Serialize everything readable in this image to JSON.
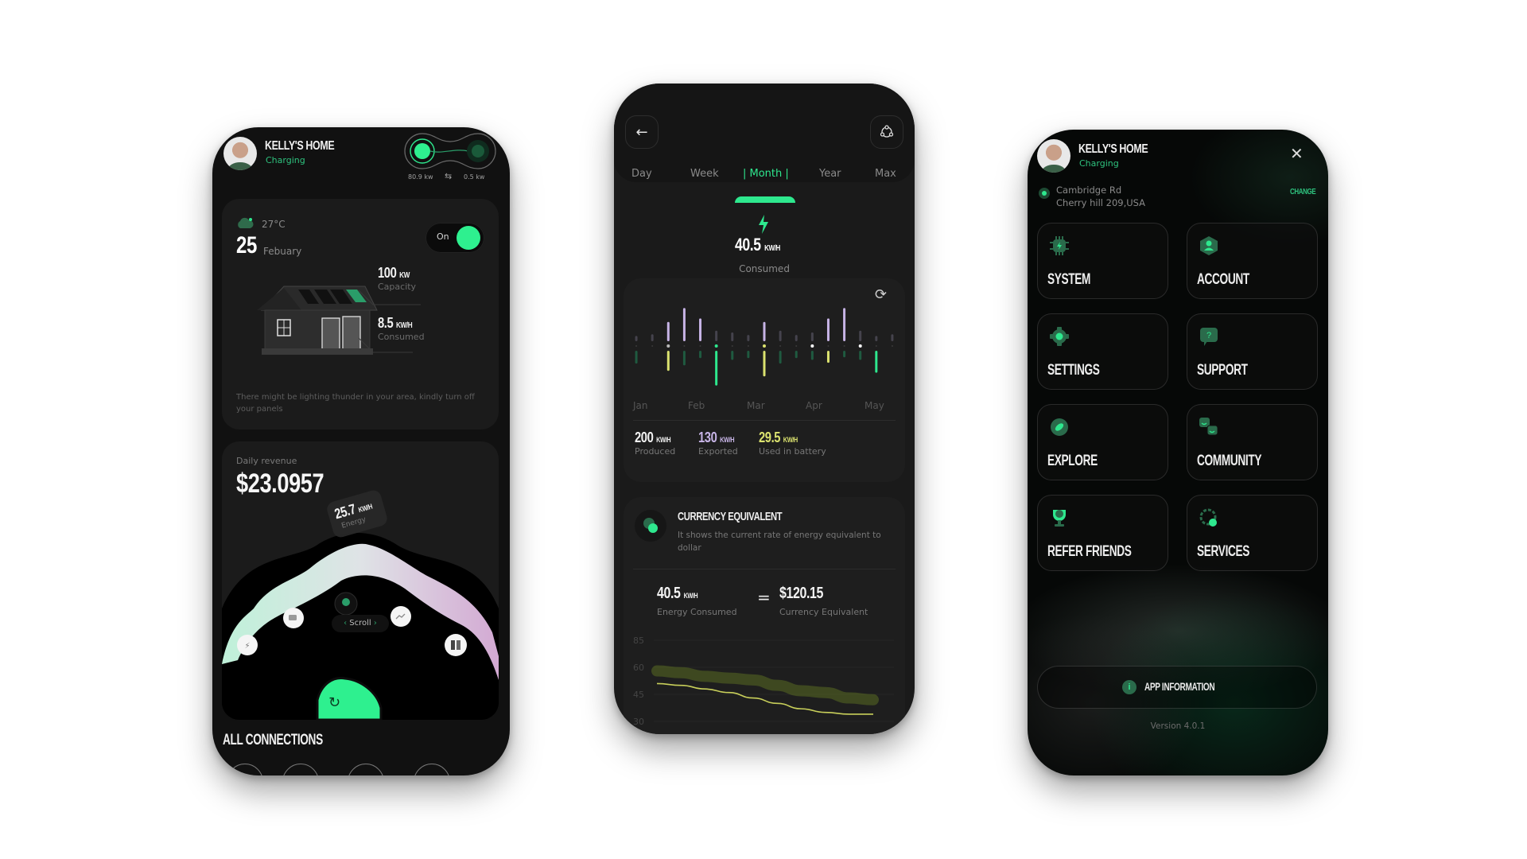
{
  "colors": {
    "accent_green": "#2ee88e",
    "exported_purple": "#c7b4e6",
    "battery_yellow": "#dbe26f",
    "background": "#ffffff"
  },
  "home_screen": {
    "header": {
      "title": "KELLY'S HOME",
      "status": "Charging"
    },
    "energy_flow": {
      "left_value": "80.9 kw",
      "right_value": "0.5 kw",
      "swap_icon": "swap-arrows-icon"
    },
    "weather_card": {
      "weather_icon": "cloud-icon",
      "temperature": "27°C",
      "day": "25",
      "month": "Febuary",
      "toggle_label": "On",
      "toggle_on": true,
      "capacity": {
        "value": "100",
        "unit": "KW",
        "label": "Capacity"
      },
      "consumed": {
        "value": "8.5",
        "unit": "KW/H",
        "label": "Consumed"
      },
      "alert": "There might be lighting thunder in your area, kindly turn off your panels"
    },
    "revenue_card": {
      "label": "Daily revenue",
      "amount": "$23.0957",
      "energy_badge": {
        "value": "25.7",
        "unit": "KW/H",
        "label": "Energy"
      },
      "dial_icons": [
        "lightning-icon",
        "battery-icon",
        "lightbulb-icon",
        "chart-cloud-icon",
        "panel-icon"
      ],
      "scroll_label": "Scroll",
      "refresh_icon": "refresh-icon"
    },
    "connections": {
      "title": "ALL CONNECTIONS"
    }
  },
  "stats_screen": {
    "back_icon": "arrow-left-icon",
    "share_icon": "share-nodes-icon",
    "period_tabs": [
      {
        "label": "Day",
        "active": false
      },
      {
        "label": "Week",
        "active": false
      },
      {
        "label": "| Month |",
        "active": true
      },
      {
        "label": "Year",
        "active": false
      },
      {
        "label": "Max",
        "active": false
      }
    ],
    "consumed": {
      "value": "40.5",
      "unit": "KW/H",
      "label": "Consumed"
    },
    "sync_icon": "sync-icon",
    "month_labels": [
      "Jan",
      "Feb",
      "Mar",
      "Apr",
      "May"
    ],
    "bars": [
      {
        "up": 0.15,
        "down": 0.35,
        "up_color": "dim",
        "down_color": "teal",
        "dot": "none"
      },
      {
        "up": 0.2,
        "down": 0.0,
        "up_color": "dim",
        "down_color": "teal",
        "dot": "none"
      },
      {
        "up": 0.55,
        "down": 0.55,
        "up_color": "purple",
        "down_color": "yellow",
        "dot": "gray"
      },
      {
        "up": 0.95,
        "down": 0.4,
        "up_color": "purple",
        "down_color": "teal",
        "dot": "none"
      },
      {
        "up": 0.65,
        "down": 0.2,
        "up_color": "purple",
        "down_color": "teal",
        "dot": "none"
      },
      {
        "up": 0.3,
        "down": 0.95,
        "up_color": "dim",
        "down_color": "green",
        "dot": "green"
      },
      {
        "up": 0.25,
        "down": 0.25,
        "up_color": "dim",
        "down_color": "teal",
        "dot": "none"
      },
      {
        "up": 0.18,
        "down": 0.2,
        "up_color": "dim",
        "down_color": "teal",
        "dot": "none"
      },
      {
        "up": 0.55,
        "down": 0.7,
        "up_color": "purple",
        "down_color": "yellow",
        "dot": "yellow"
      },
      {
        "up": 0.3,
        "down": 0.35,
        "up_color": "dim",
        "down_color": "teal",
        "dot": "none"
      },
      {
        "up": 0.18,
        "down": 0.2,
        "up_color": "dim",
        "down_color": "teal",
        "dot": "none"
      },
      {
        "up": 0.25,
        "down": 0.25,
        "up_color": "dim",
        "down_color": "teal",
        "dot": "white"
      },
      {
        "up": 0.65,
        "down": 0.33,
        "up_color": "purple",
        "down_color": "yellow",
        "dot": "none"
      },
      {
        "up": 0.95,
        "down": 0.18,
        "up_color": "purple",
        "down_color": "teal",
        "dot": "none"
      },
      {
        "up": 0.3,
        "down": 0.25,
        "up_color": "dim",
        "down_color": "teal",
        "dot": "white"
      },
      {
        "up": 0.15,
        "down": 0.6,
        "up_color": "dim",
        "down_color": "green",
        "dot": "none"
      },
      {
        "up": 0.2,
        "down": 0.0,
        "up_color": "dim",
        "down_color": "teal",
        "dot": "none"
      }
    ],
    "legend": [
      {
        "value": "200",
        "unit": "KW/H",
        "label": "Produced",
        "color": "#f2f2f2"
      },
      {
        "value": "130",
        "unit": "KW/H",
        "label": "Exported",
        "color": "#c7b4e6"
      },
      {
        "value": "29.5",
        "unit": "KW/H",
        "label": "Used in battery",
        "color": "#dbe26f"
      }
    ],
    "currency": {
      "icon": "coins-icon",
      "title": "CURRENCY EQUIVALENT",
      "description": "It shows the current rate of energy equivalent to dollar",
      "energy_value": "40.5",
      "energy_unit": "KW/H",
      "energy_label": "Energy Consumed",
      "equals": "=",
      "amount": "$120.15",
      "amount_label": "Currency Equivalent"
    },
    "trend": {
      "y_ticks": [
        "85",
        "60",
        "45",
        "30"
      ],
      "line_values": [
        51,
        50,
        48,
        46,
        43,
        40,
        37,
        35,
        34,
        34
      ],
      "glow_values": [
        58,
        57,
        55,
        54,
        53,
        50,
        47,
        46,
        43,
        42
      ]
    }
  },
  "menu_screen": {
    "header": {
      "title": "KELLY'S HOME",
      "status": "Charging"
    },
    "close_icon": "close-icon",
    "address": {
      "line1": "Cambridge Rd",
      "line2": "Cherry hill 209,USA",
      "change_label": "CHANGE"
    },
    "tiles": [
      {
        "label": "SYSTEM",
        "icon": "chip-icon"
      },
      {
        "label": "ACCOUNT",
        "icon": "user-hexagon-icon"
      },
      {
        "label": "SETTINGS",
        "icon": "gear-icon"
      },
      {
        "label": "SUPPORT",
        "icon": "question-chat-icon"
      },
      {
        "label": "EXPLORE",
        "icon": "compass-icon"
      },
      {
        "label": "COMMUNITY",
        "icon": "community-icon"
      },
      {
        "label": "REFER FRIENDS",
        "icon": "trophy-icon"
      },
      {
        "label": "SERVICES",
        "icon": "services-gear-icon"
      }
    ],
    "app_info_label": "APP INFORMATION",
    "version": "Version 4.0.1"
  }
}
